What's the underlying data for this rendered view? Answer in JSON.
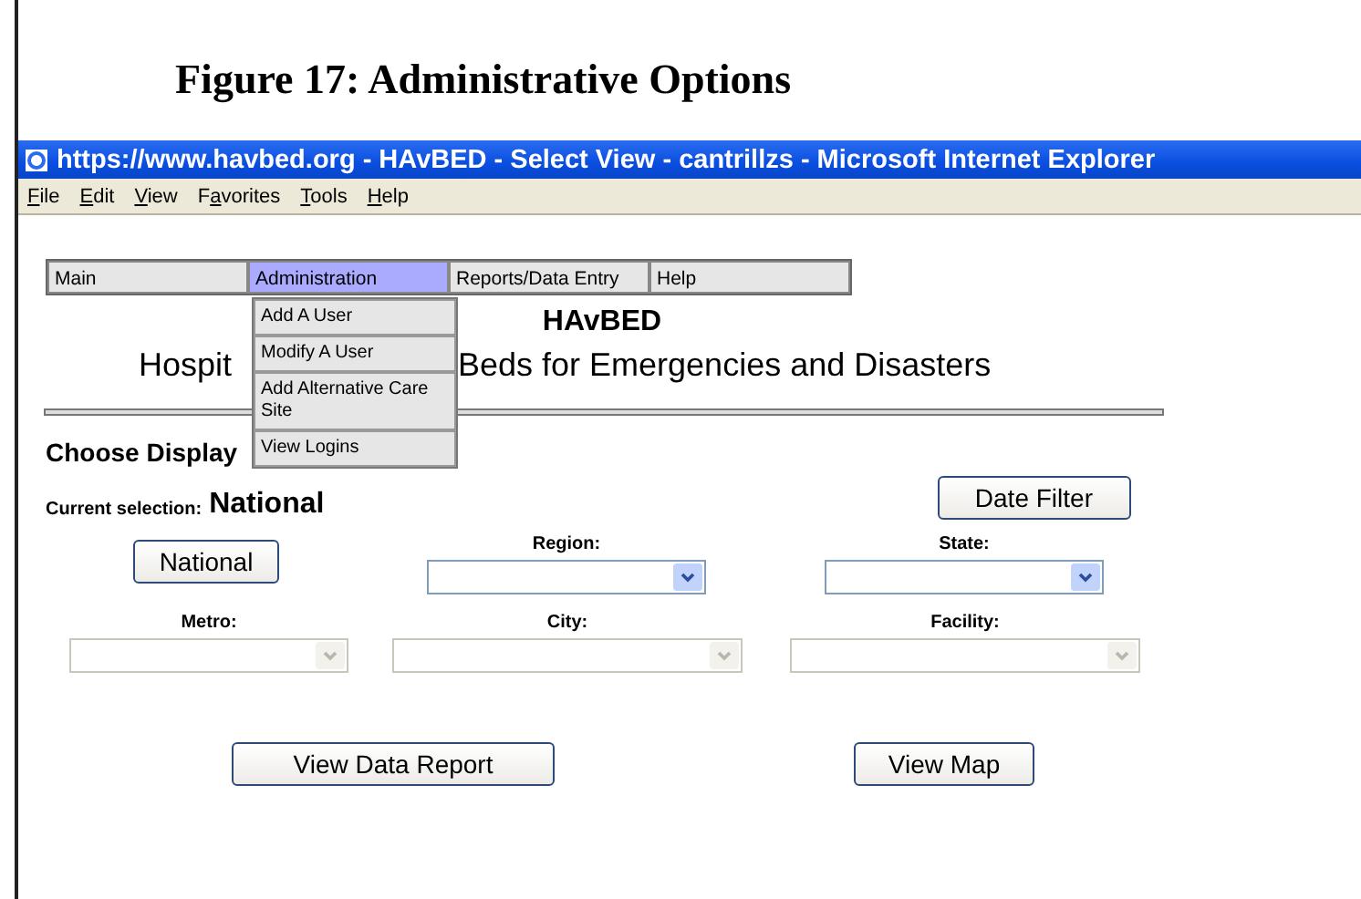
{
  "figure_caption": "Figure 17: Administrative Options",
  "window": {
    "title": "https://www.havbed.org - HAvBED - Select View - cantrillzs - Microsoft Internet Explorer"
  },
  "menu_bar": [
    {
      "key": "F",
      "post": "ile"
    },
    {
      "key": "E",
      "post": "dit"
    },
    {
      "key": "V",
      "post": "iew"
    },
    {
      "pre": "F",
      "key": "a",
      "post": "vorites"
    },
    {
      "key": "T",
      "post": "ools"
    },
    {
      "key": "H",
      "post": "elp"
    }
  ],
  "nav": [
    {
      "label": "Main",
      "selected": false
    },
    {
      "label": "Administration",
      "selected": true,
      "menu": [
        "Add A User",
        "Modify A User",
        "Add Alternative Care Site",
        "View Logins"
      ]
    },
    {
      "label": "Reports/Data Entry",
      "selected": false
    },
    {
      "label": "Help",
      "selected": false
    }
  ],
  "heading": "HAvBED",
  "subtitle_left": "Hospit",
  "subtitle_right": "Beds for Emergencies and Disasters",
  "section_title": "Choose Display",
  "current_selection": {
    "label": "Current selection:",
    "value": "National"
  },
  "date_filter_button": "Date Filter",
  "national_button": "National",
  "fields": [
    {
      "label": "Region:",
      "disabled": false
    },
    {
      "label": "State:",
      "disabled": false
    },
    {
      "label": "Metro:",
      "disabled": true
    },
    {
      "label": "City:",
      "disabled": true
    },
    {
      "label": "Facility:",
      "disabled": true
    }
  ],
  "buttons": [
    "View Data Report",
    "View Map"
  ]
}
